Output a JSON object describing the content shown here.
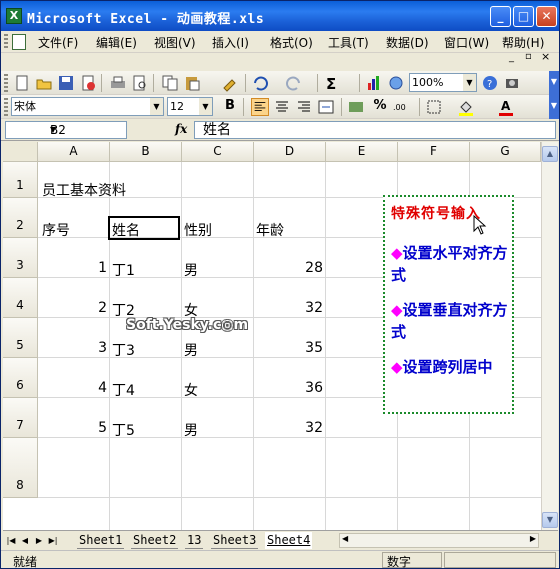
{
  "window": {
    "title": "Microsoft Excel - 动画教程.xls"
  },
  "menu": {
    "items": [
      "文件(F)",
      "编辑(E)",
      "视图(V)",
      "插入(I)",
      "格式(O)",
      "工具(T)",
      "数据(D)",
      "窗口(W)",
      "帮助(H)"
    ],
    "controls": [
      "_",
      "▫",
      "×"
    ]
  },
  "standard_toolbar": {
    "zoom": "100%"
  },
  "formatting_toolbar": {
    "font_name": "宋体",
    "font_size": "12"
  },
  "formula_bar": {
    "name_box": "B2",
    "fx_label": "fx",
    "content": "姓名"
  },
  "grid": {
    "columns": [
      "A",
      "B",
      "C",
      "D",
      "E",
      "F",
      "G"
    ],
    "rows": [
      "1",
      "2",
      "3",
      "4",
      "5",
      "6",
      "7",
      "8"
    ],
    "title": "员工基本资料",
    "headers": [
      "序号",
      "姓名",
      "性别",
      "年龄"
    ],
    "records": [
      {
        "id": "1",
        "name": "丁1",
        "gender": "男",
        "age": "28"
      },
      {
        "id": "2",
        "name": "丁2",
        "gender": "女",
        "age": "32"
      },
      {
        "id": "3",
        "name": "丁3",
        "gender": "男",
        "age": "35"
      },
      {
        "id": "4",
        "name": "丁4",
        "gender": "女",
        "age": "36"
      },
      {
        "id": "5",
        "name": "丁5",
        "gender": "男",
        "age": "32"
      }
    ]
  },
  "callout": {
    "title": "特殊符号输入",
    "items": [
      "设置水平对齐方式",
      "设置垂直对齐方式",
      "设置跨列居中"
    ],
    "bullet": "◆"
  },
  "watermark": "Soft.Yesky.c◎m",
  "sheet_tabs": [
    "Sheet1",
    "Sheet2",
    "13",
    "Sheet3",
    "Sheet4"
  ],
  "active_sheet": "Sheet4",
  "status": {
    "ready": "就绪",
    "num_lock": "数字"
  },
  "colors": {
    "title_bar": "#1a5fd6",
    "callout_border": "#1b8a2b",
    "callout_title": "#e00000",
    "callout_text": "#0000cc",
    "bullet": "#ff00ff"
  }
}
